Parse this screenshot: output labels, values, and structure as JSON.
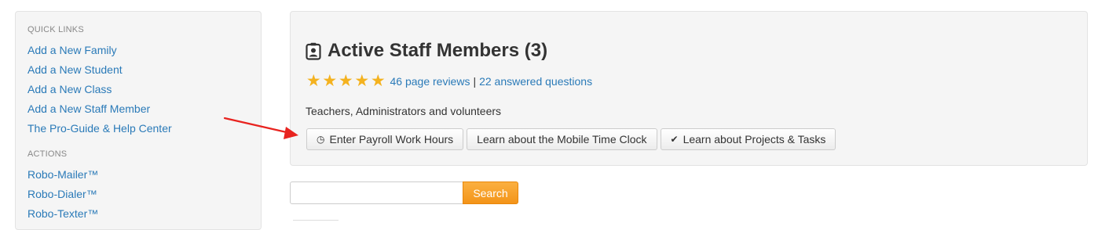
{
  "sidebar": {
    "quick_links_heading": "QUICK LINKS",
    "quick_links": [
      {
        "label": "Add a New Family"
      },
      {
        "label": "Add a New Student"
      },
      {
        "label": "Add a New Class"
      },
      {
        "label": "Add a New Staff Member"
      },
      {
        "label": "The Pro-Guide & Help Center"
      }
    ],
    "actions_heading": "ACTIONS",
    "actions": [
      {
        "label": "Robo-Mailer™"
      },
      {
        "label": "Robo-Dialer™"
      },
      {
        "label": "Robo-Texter™"
      }
    ]
  },
  "panel": {
    "title": "Active Staff Members (3)",
    "title_icon": "id-badge-icon",
    "rating": {
      "stars": 5,
      "reviews_label": "46 page reviews",
      "separator": "|",
      "questions_label": "22 answered questions"
    },
    "subtitle": "Teachers, Administrators and volunteers",
    "buttons": [
      {
        "label": "Enter Payroll Work Hours",
        "icon": "clock-icon",
        "glyph": "◷"
      },
      {
        "label": "Learn about the Mobile Time Clock"
      },
      {
        "label": "Learn about Projects & Tasks",
        "icon": "checkmark-icon",
        "glyph": "✔"
      }
    ]
  },
  "search": {
    "value": "",
    "button_label": "Search"
  },
  "colors": {
    "link": "#2a7ab8",
    "star": "#f4b21f",
    "search_button": "#f39419",
    "annotation_arrow": "#e8231f"
  }
}
